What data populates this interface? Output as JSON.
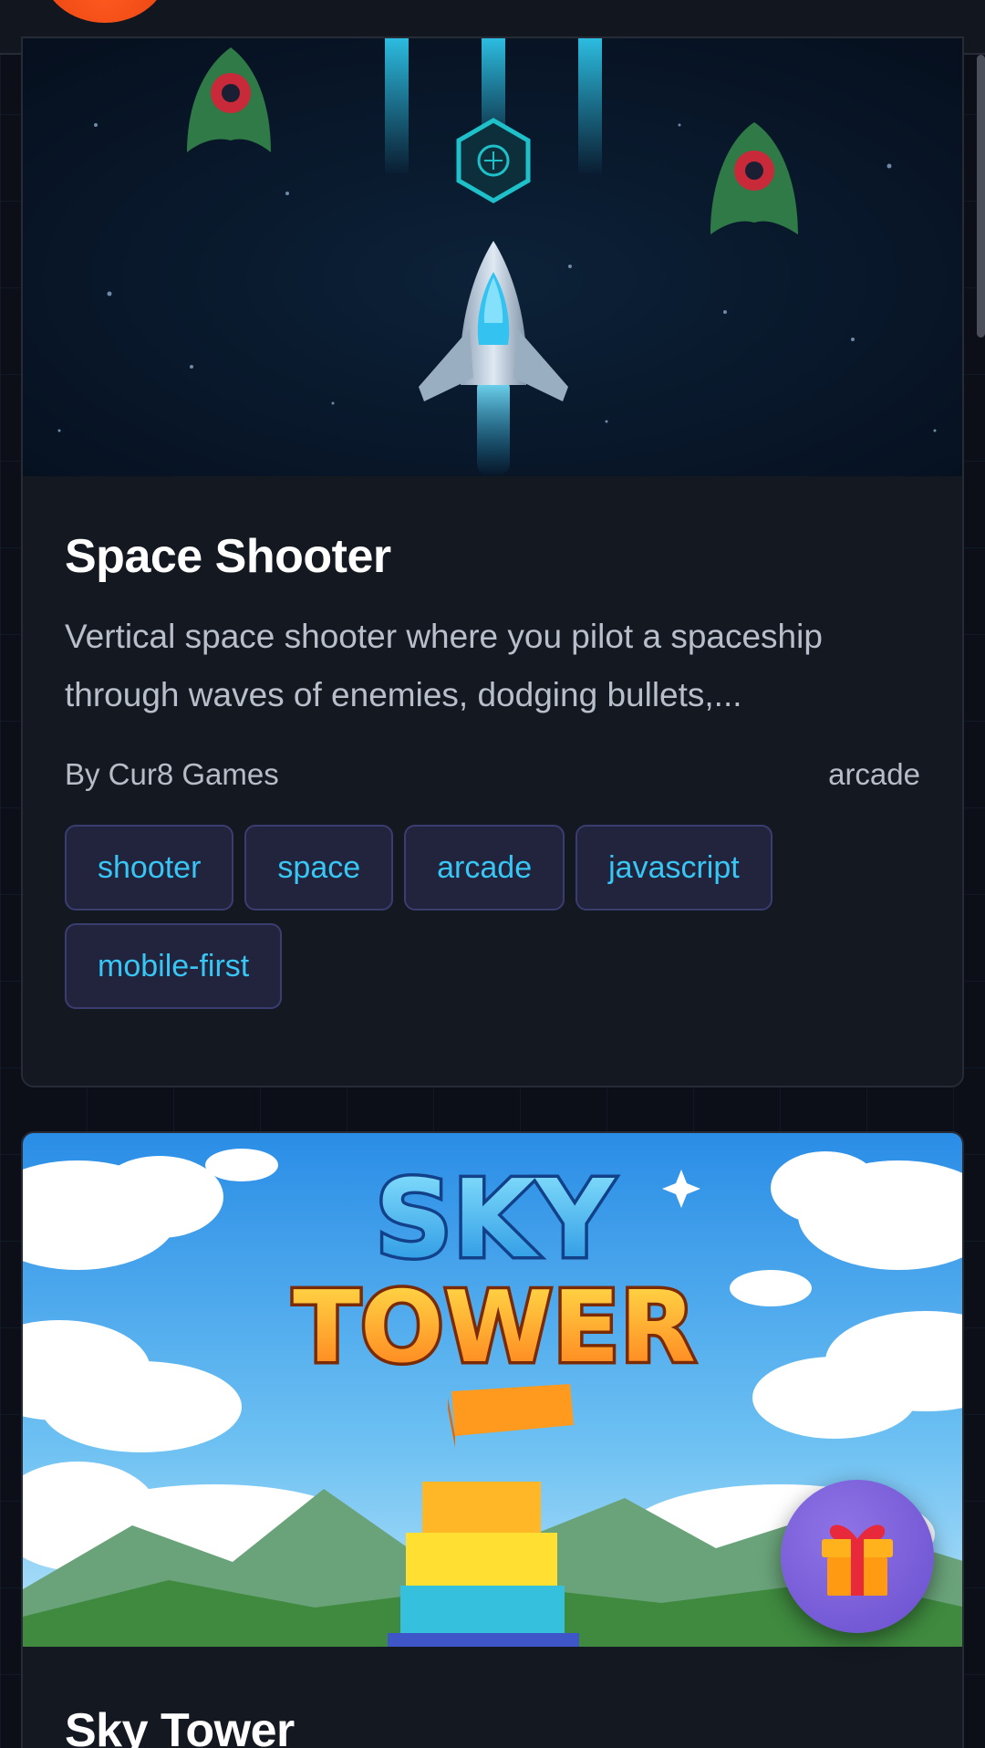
{
  "cards": [
    {
      "title": "Space Shooter",
      "description": "Vertical space shooter where you pilot a spaceship through waves of enemies, dodging bullets,...",
      "author": "By Cur8 Games",
      "category": "arcade",
      "tags": [
        "shooter",
        "space",
        "arcade",
        "javascript",
        "mobile-first"
      ],
      "thumbnail_icon": "spaceship-thumbnail"
    },
    {
      "title": "Sky Tower",
      "thumbnail_text_line1": "SKY",
      "thumbnail_text_line2": "TOWER",
      "thumbnail_icon": "stacked-blocks-thumbnail"
    }
  ],
  "fab": {
    "icon": "gift-icon"
  },
  "colors": {
    "background": "#0c0f17",
    "card": "#141821",
    "tag_bg": "#22243d",
    "tag_border": "#3b3d71",
    "tag_text": "#38c6f4",
    "fab": "#7a5fda",
    "logo": "#ff5a1f"
  }
}
